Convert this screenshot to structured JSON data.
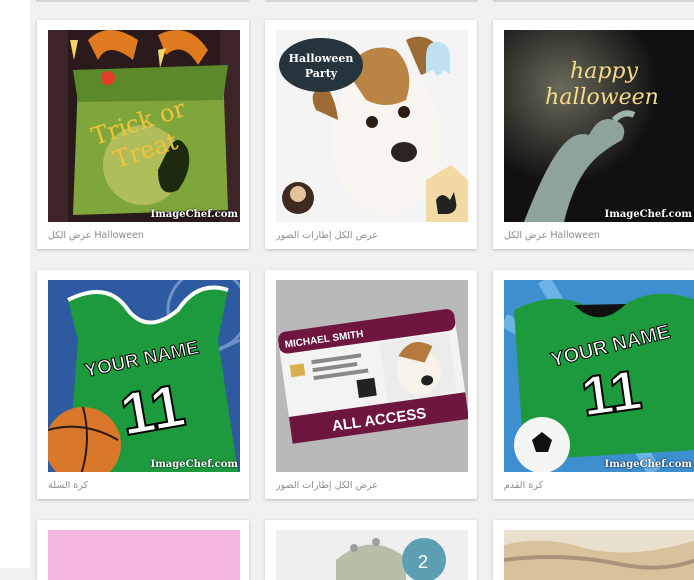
{
  "watermark": "ImageChef.com",
  "cards": [
    {
      "caption": "عرض الكل Halloween",
      "texts": {
        "line1": "Trick or",
        "line2": "Treat"
      }
    },
    {
      "caption": "عرض الكل إطارات الصور",
      "texts": {
        "badge1": "Halloween",
        "badge2": "Party"
      }
    },
    {
      "caption": "عرض الكل Halloween",
      "texts": {
        "line1": "happy",
        "line2": "halloween"
      }
    },
    {
      "caption": "كرة السلة",
      "texts": {
        "name": "YOUR NAME",
        "number": "11"
      }
    },
    {
      "caption": "عرض الكل إطارات الصور",
      "texts": {
        "name": "MICHAEL SMITH",
        "access": "ALL ACCESS"
      }
    },
    {
      "caption": "كرة القدم",
      "texts": {
        "name": "YOUR NAME",
        "number": "11"
      }
    },
    {
      "caption": "",
      "texts": {}
    },
    {
      "caption": "",
      "texts": {
        "counter": "2"
      }
    },
    {
      "caption": "",
      "texts": {}
    }
  ]
}
